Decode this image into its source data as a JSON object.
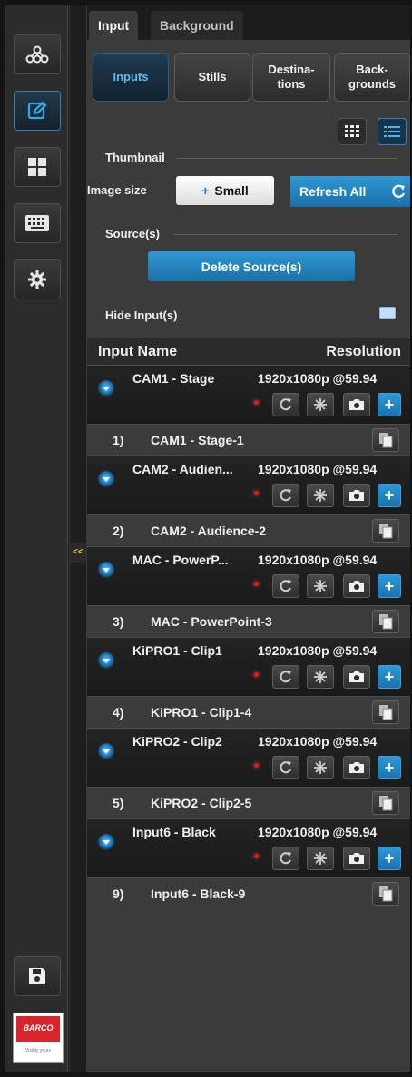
{
  "rail": {
    "items": [
      {
        "icon": "network-icon"
      },
      {
        "icon": "edit-icon",
        "active": true
      },
      {
        "icon": "grid-layout-icon"
      },
      {
        "icon": "keyboard-icon"
      },
      {
        "icon": "gear-icon"
      }
    ],
    "save_icon": "save-icon",
    "logo_text": "BARCO",
    "logo_subtext": "Visibly yours"
  },
  "collapse_label": "<<",
  "top_tabs": [
    {
      "label": "Input",
      "active": true
    },
    {
      "label": "Background",
      "active": false
    }
  ],
  "segments": [
    {
      "label": "Inputs",
      "active": true
    },
    {
      "label": "Stills",
      "active": false
    },
    {
      "label": "Destina-\ntions",
      "active": false
    },
    {
      "label": "Back-\ngrounds",
      "active": false
    }
  ],
  "view_toggle": {
    "grid_icon": "grid-view-icon",
    "list_icon": "list-view-icon",
    "active": "list"
  },
  "thumbnail": {
    "section_label": "Thumbnail",
    "image_size_label": "Image size",
    "size_value": "Small",
    "refresh_label": "Refresh All"
  },
  "sources": {
    "section_label": "Source(s)",
    "delete_label": "Delete Source(s)",
    "hide_label": "Hide Input(s)"
  },
  "table": {
    "col_name": "Input Name",
    "col_resolution": "Resolution",
    "rows": [
      {
        "name": "CAM1 - Stage",
        "resolution": "1920x1080p @59.94",
        "dest_num": "1)",
        "dest_name": "CAM1 - Stage-1"
      },
      {
        "name": "CAM2 - Audien...",
        "resolution": "1920x1080p @59.94",
        "dest_num": "2)",
        "dest_name": "CAM2 - Audience-2"
      },
      {
        "name": "MAC - PowerP...",
        "resolution": "1920x1080p @59.94",
        "dest_num": "3)",
        "dest_name": "MAC - PowerPoint-3"
      },
      {
        "name": "KiPRO1 - Clip1",
        "resolution": "1920x1080p @59.94",
        "dest_num": "4)",
        "dest_name": "KiPRO1 - Clip1-4"
      },
      {
        "name": "KiPRO2 - Clip2",
        "resolution": "1920x1080p @59.94",
        "dest_num": "5)",
        "dest_name": "KiPRO2 - Clip2-5"
      },
      {
        "name": "Input6 - Black",
        "resolution": "1920x1080p @59.94",
        "dest_num": "9)",
        "dest_name": "Input6 - Black-9"
      }
    ]
  },
  "colors": {
    "accent": "#2f98d6",
    "status_red": "#e01a1a",
    "panel_bg": "#3b3b3b"
  }
}
